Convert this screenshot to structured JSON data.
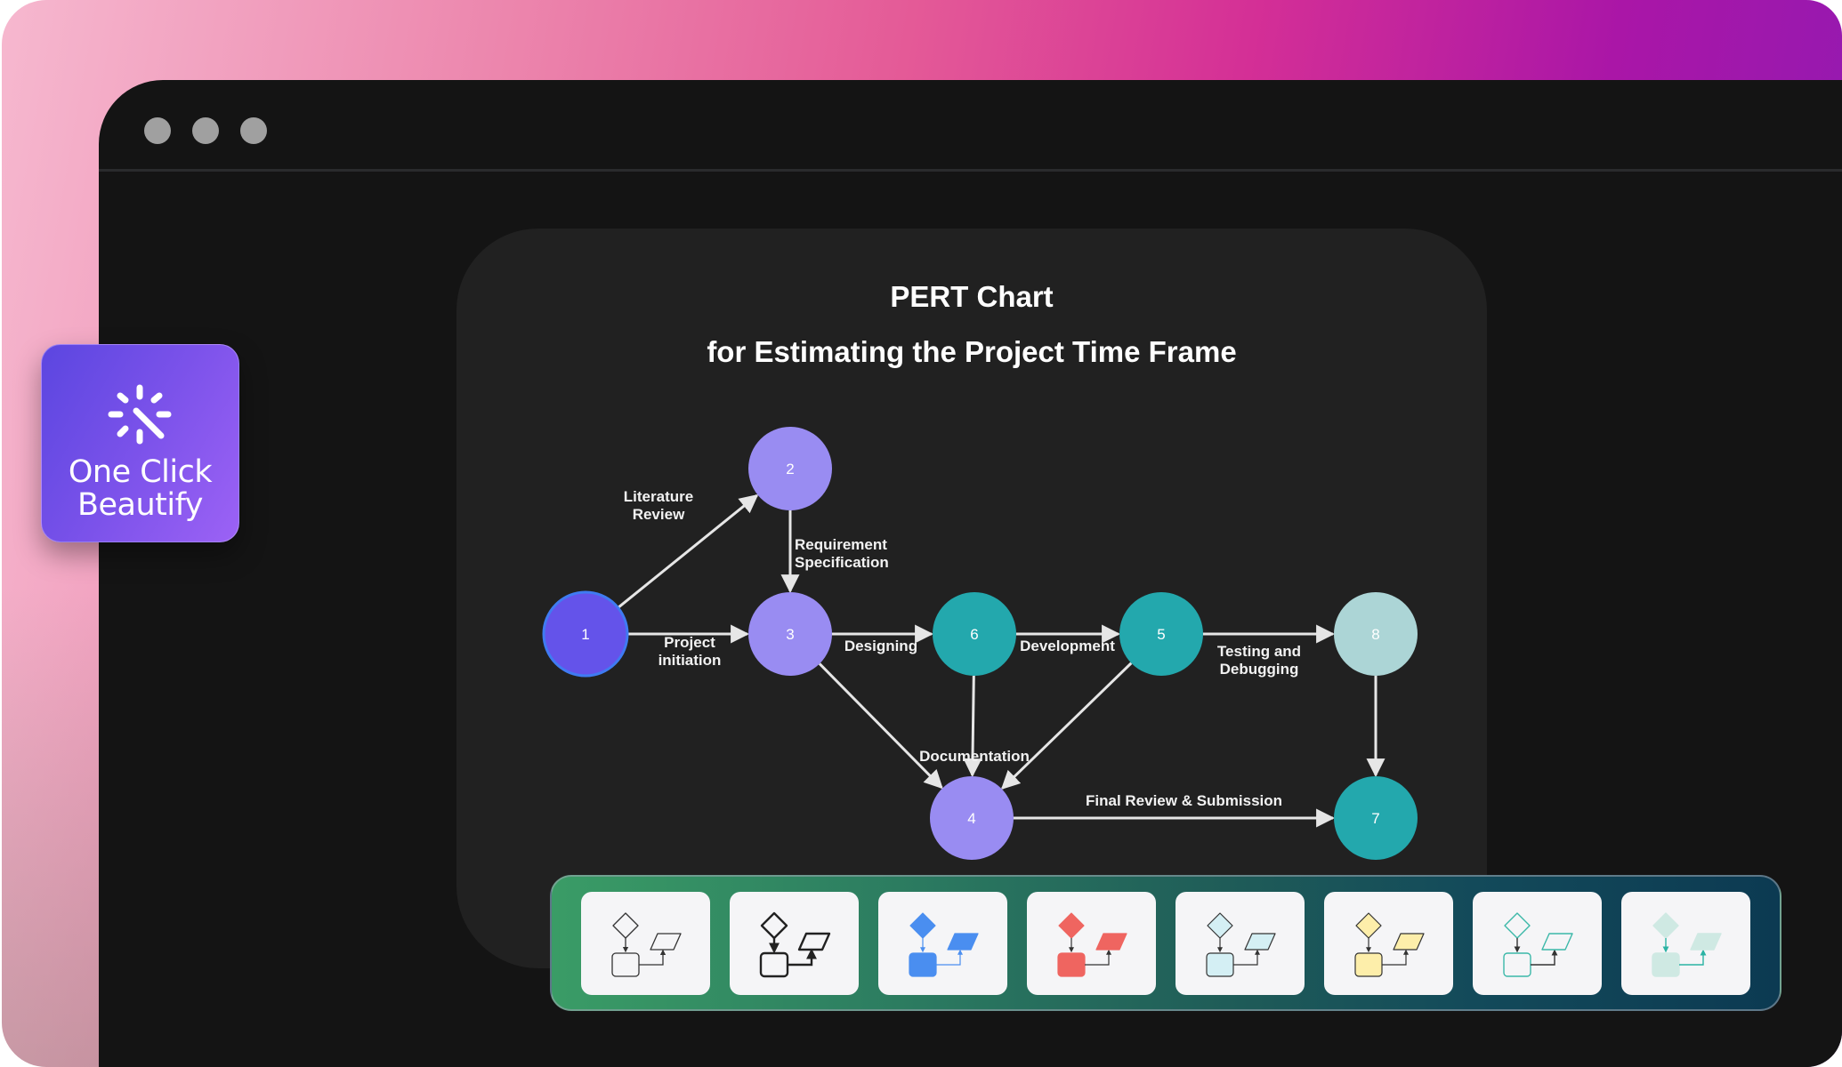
{
  "window": {
    "controls": [
      "window-dot-1",
      "window-dot-2",
      "window-dot-3"
    ]
  },
  "badge": {
    "icon": "magic-wand-sparkle-icon",
    "line1": "One Click",
    "line2": "Beautify"
  },
  "chart_data": {
    "type": "pert-network",
    "title": "PERT Chart",
    "subtitle": "for Estimating the Project Time Frame",
    "nodes": [
      {
        "id": "1",
        "label": "1",
        "color": "#6453ea",
        "stroke": "#3f7bf2"
      },
      {
        "id": "2",
        "label": "2",
        "color": "#998cf2"
      },
      {
        "id": "3",
        "label": "3",
        "color": "#998cf2"
      },
      {
        "id": "4",
        "label": "4",
        "color": "#998cf2"
      },
      {
        "id": "5",
        "label": "5",
        "color": "#23a8ad"
      },
      {
        "id": "6",
        "label": "6",
        "color": "#23a8ad"
      },
      {
        "id": "7",
        "label": "7",
        "color": "#23a8ad"
      },
      {
        "id": "8",
        "label": "8",
        "color": "#acd5d6"
      }
    ],
    "edges": [
      {
        "from": "1",
        "to": "2",
        "label": "Literature Review"
      },
      {
        "from": "1",
        "to": "3",
        "label": "Project initiation"
      },
      {
        "from": "2",
        "to": "3",
        "label": "Requirement Specification"
      },
      {
        "from": "3",
        "to": "6",
        "label": "Designing"
      },
      {
        "from": "6",
        "to": "5",
        "label": "Development"
      },
      {
        "from": "5",
        "to": "8",
        "label": "Testing and Debugging"
      },
      {
        "from": "3",
        "to": "4",
        "label": ""
      },
      {
        "from": "6",
        "to": "4",
        "label": "Documentation"
      },
      {
        "from": "5",
        "to": "4",
        "label": ""
      },
      {
        "from": "8",
        "to": "7",
        "label": ""
      },
      {
        "from": "4",
        "to": "7",
        "label": "Final Review & Submission"
      }
    ],
    "edge_labels": {
      "literature_1": "Literature",
      "literature_2": "Review",
      "project_1": "Project",
      "project_2": "initiation",
      "requirement_1": "Requirement",
      "requirement_2": "Specification",
      "designing": "Designing",
      "development": "Development",
      "testing_1": "Testing and",
      "testing_2": "Debugging",
      "documentation": "Documentation",
      "final": "Final Review & Submission"
    }
  },
  "palette": {
    "themes": [
      {
        "name": "outline-thin",
        "fill": "none",
        "stroke": "#333333",
        "line": "#333333",
        "weight": 1.3
      },
      {
        "name": "outline-bold",
        "fill": "none",
        "stroke": "#222222",
        "line": "#222222",
        "weight": 2.4
      },
      {
        "name": "blue",
        "fill": "#4a8ef0",
        "stroke": "#4a8ef0",
        "line": "#4a8ef0",
        "weight": 1.2
      },
      {
        "name": "red",
        "fill": "#ef6560",
        "stroke": "#ef6560",
        "line": "#333333",
        "weight": 1.2
      },
      {
        "name": "light-cyan",
        "fill": "#d4eff4",
        "stroke": "#333333",
        "line": "#333333",
        "weight": 1.2
      },
      {
        "name": "yellow",
        "fill": "#fdeeaa",
        "stroke": "#333333",
        "line": "#333333",
        "weight": 1.2
      },
      {
        "name": "teal-outline",
        "fill": "none",
        "stroke": "#3bb8a8",
        "line": "#333333",
        "weight": 1.4
      },
      {
        "name": "mint",
        "fill": "#cfe9e3",
        "stroke": "#cfe9e3",
        "line": "#2bb3a4",
        "weight": 1.4
      }
    ]
  }
}
